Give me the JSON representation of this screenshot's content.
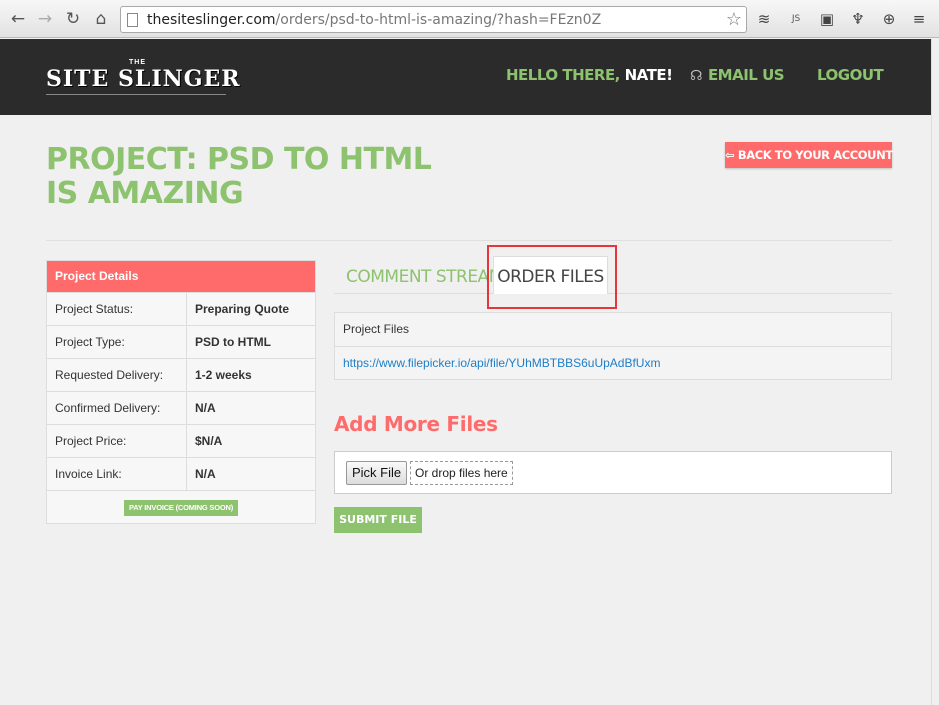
{
  "browser": {
    "url_host": "thesiteslinger.com",
    "url_path": "/orders/psd-to-html-is-amazing/?hash=FEzn0Z",
    "icons": [
      "back-icon",
      "forward-icon",
      "reload-icon",
      "home-icon",
      "page-icon",
      "star-icon",
      "buffer-icon",
      "js-icon",
      "window-icon",
      "cup-icon",
      "extension-plus-icon",
      "menu-icon"
    ],
    "ext_js_label": "JS"
  },
  "header": {
    "logo_the": "THE",
    "logo_name": "SITE SLINGER",
    "greeting": "HELLO THERE,",
    "username": "NATE!",
    "email_label": "EMAIL US",
    "logout_label": "LOGOUT"
  },
  "page": {
    "title": "PROJECT: PSD TO HTML IS AMAZING",
    "back_button": "BACK TO YOUR ACCOUNT"
  },
  "details": {
    "heading": "Project Details",
    "rows": [
      {
        "label": "Project Status:",
        "value": "Preparing Quote"
      },
      {
        "label": "Project Type:",
        "value": "PSD to HTML"
      },
      {
        "label": "Requested Delivery:",
        "value": "1-2 weeks"
      },
      {
        "label": "Confirmed Delivery:",
        "value": "N/A"
      },
      {
        "label": "Project Price:",
        "value": "$N/A"
      },
      {
        "label": "Invoice Link:",
        "value": "N/A"
      }
    ],
    "pay_button": "PAY INVOICE (COMING SOON)"
  },
  "tabs": [
    {
      "label": "COMMENT STREAM",
      "active": false
    },
    {
      "label": "ORDER FILES",
      "active": true
    }
  ],
  "files": {
    "header": "Project Files",
    "link": "https://www.filepicker.io/api/file/YUhMBTBBS6uUpAdBfUxm"
  },
  "upload": {
    "title": "Add More Files",
    "pick_button": "Pick File",
    "drop_hint": "Or drop files here",
    "submit_button": "SUBMIT FILE"
  },
  "colors": {
    "accent_green": "#8dc26f",
    "accent_red": "#ff6b6b",
    "header_bg": "#2b2b2b",
    "link_blue": "#1f7ec7",
    "highlight_red": "#e8343b"
  }
}
